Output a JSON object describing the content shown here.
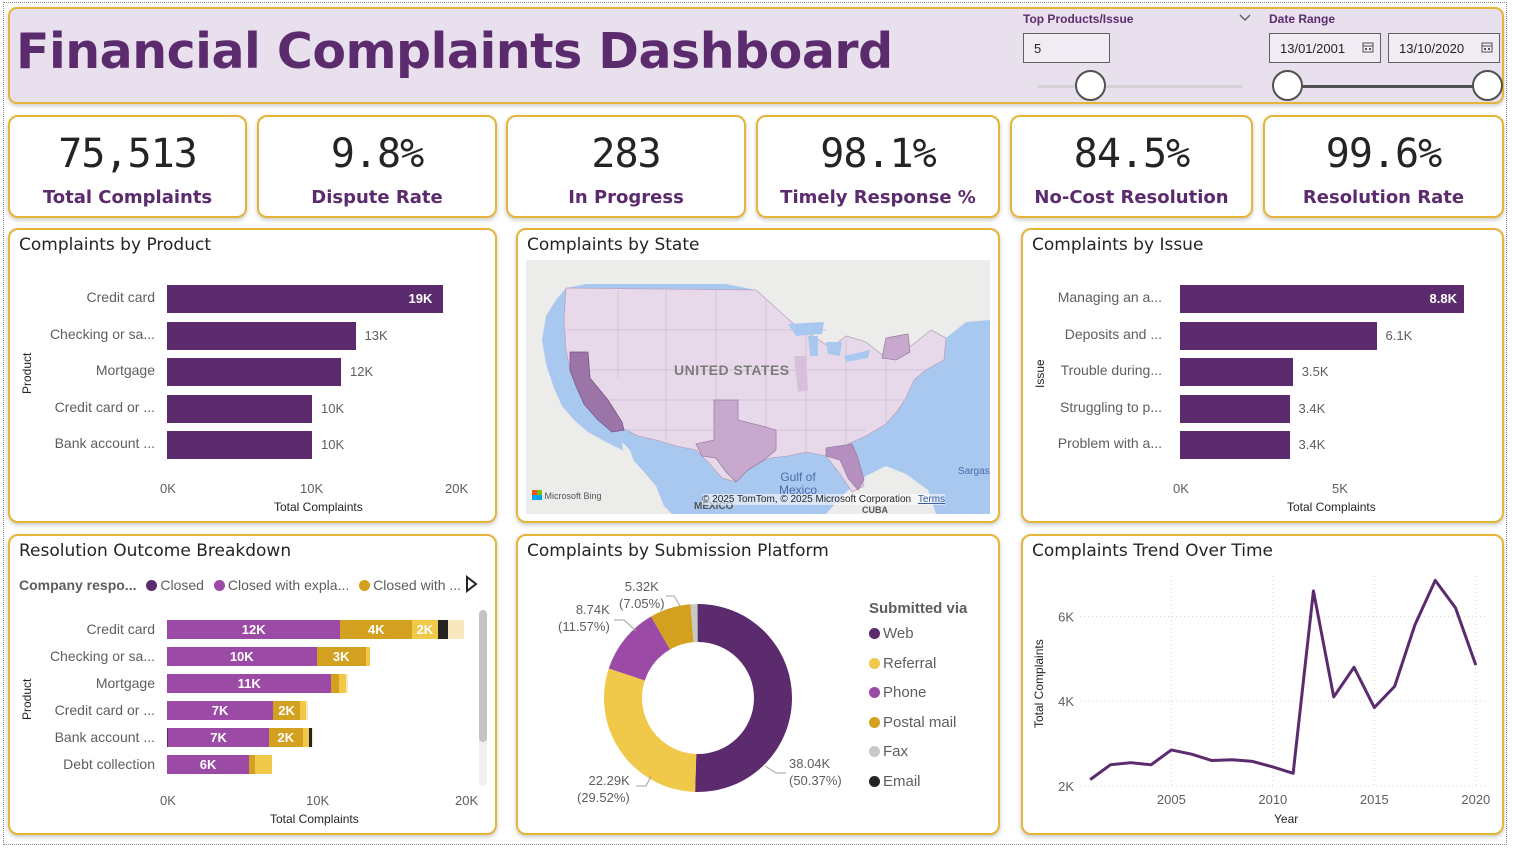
{
  "header": {
    "title": "Financial Complaints Dashboard",
    "top_slicer": {
      "label": "Top Products/Issue",
      "value": "5",
      "slider_fraction": 0.25
    },
    "date_slicer": {
      "label": "Date Range",
      "start": "13/01/2001",
      "end": "13/10/2020"
    }
  },
  "kpis": [
    {
      "value": "75,513",
      "label": "Total Complaints"
    },
    {
      "value": "9.8%",
      "label": "Dispute Rate"
    },
    {
      "value": "283",
      "label": "In Progress"
    },
    {
      "value": "98.1%",
      "label": "Timely Response %"
    },
    {
      "value": "84.5%",
      "label": "No-Cost Resolution"
    },
    {
      "value": "99.6%",
      "label": "Resolution Rate"
    }
  ],
  "product_chart": {
    "title": "Complaints by Product",
    "xlabel": "Total Complaints",
    "ylabel": "Product",
    "ticks": [
      "0K",
      "10K",
      "20K"
    ]
  },
  "state_map": {
    "title": "Complaints by State",
    "country_label": "UNITED STATES",
    "gulf_label": "Gulf of Mexico",
    "mexico_label": "MÉXICO",
    "cuba_label": "CUBA",
    "sargasso_label": "Sargas",
    "bing_label": "Microsoft Bing",
    "copyright": "© 2025 TomTom, © 2025 Microsoft Corporation",
    "terms": "Terms"
  },
  "issue_chart": {
    "title": "Complaints by Issue",
    "xlabel": "Total Complaints",
    "ylabel": "Issue",
    "ticks": [
      "0K",
      "5K"
    ]
  },
  "resolution_chart": {
    "title": "Resolution Outcome Breakdown",
    "legend_title": "Company respo...",
    "xlabel": "Total Complaints",
    "ylabel": "Product",
    "ticks": [
      "0K",
      "10K",
      "20K"
    ]
  },
  "platform_chart": {
    "title": "Complaints by Submission Platform",
    "legend_title": "Submitted via"
  },
  "trend_chart": {
    "title": "Complaints Trend Over Time",
    "xlabel": "Year",
    "ylabel": "Total Complaints",
    "xticks": [
      "2005",
      "2010",
      "2015",
      "2020"
    ],
    "yticks": [
      "2K",
      "4K",
      "6K"
    ]
  },
  "colors": {
    "purple": "#5c2b6e",
    "light_purple": "#9b4aa5",
    "gold": "#d4a020",
    "yellow": "#f0c84a",
    "grey": "#c8c8c8",
    "black": "#252423",
    "border": "#e5b53a"
  },
  "chart_data": [
    {
      "type": "bar",
      "title": "Complaints by Product",
      "xlabel": "Total Complaints",
      "ylabel": "Product",
      "categories": [
        "Credit card",
        "Checking or sa...",
        "Mortgage",
        "Credit card or ...",
        "Bank account ..."
      ],
      "values": [
        19000,
        13000,
        12000,
        10000,
        10000
      ],
      "data_labels": [
        "19K",
        "13K",
        "12K",
        "10K",
        "10K"
      ],
      "xlim": [
        0,
        20000
      ]
    },
    {
      "type": "bar",
      "title": "Complaints by Issue",
      "xlabel": "Total Complaints",
      "ylabel": "Issue",
      "categories": [
        "Managing an a...",
        "Deposits and ...",
        "Trouble during...",
        "Struggling to p...",
        "Problem with a..."
      ],
      "values": [
        8800,
        6100,
        3500,
        3400,
        3400
      ],
      "data_labels": [
        "8.8K",
        "6.1K",
        "3.5K",
        "3.4K",
        "3.4K"
      ],
      "xlim": [
        0,
        9000
      ]
    },
    {
      "type": "bar",
      "title": "Resolution Outcome Breakdown",
      "xlabel": "Total Complaints",
      "ylabel": "Product",
      "categories": [
        "Credit card",
        "Checking or sa...",
        "Mortgage",
        "Credit card or ...",
        "Bank account ...",
        "Debt collection"
      ],
      "series": [
        {
          "name": "Closed",
          "values": [
            0,
            0,
            0,
            0,
            100,
            0
          ]
        },
        {
          "name": "Closed with expla...",
          "values": [
            11600,
            10000,
            11000,
            7100,
            6700,
            5500
          ],
          "data_labels": [
            "12K",
            "10K",
            "11K",
            "7K",
            "7K",
            "6K"
          ]
        },
        {
          "name": "Closed with ...",
          "values": [
            4800,
            3300,
            500,
            1800,
            2300,
            400
          ],
          "data_labels": [
            "4K",
            "3K",
            "",
            "2K",
            "2K",
            ""
          ]
        },
        {
          "name": "",
          "values": [
            1700,
            300,
            500,
            400,
            400,
            1100
          ],
          "data_labels": [
            "2K",
            "",
            "",
            "",
            "",
            ""
          ]
        },
        {
          "name": "",
          "values": [
            700,
            0,
            0,
            0,
            200,
            0
          ]
        },
        {
          "name": "",
          "values": [
            1100,
            0,
            100,
            100,
            100,
            0
          ]
        }
      ],
      "xlim": [
        0,
        20000
      ]
    },
    {
      "type": "pie",
      "title": "Complaints by Submission Platform",
      "legend_title": "Submitted via",
      "categories": [
        "Web",
        "Referral",
        "Phone",
        "Postal mail",
        "Fax",
        "Email"
      ],
      "values": [
        38040,
        22290,
        8740,
        5320,
        900,
        50
      ],
      "slice_labels": [
        {
          "value": "38.04K",
          "pct": "(50.37%)"
        },
        {
          "value": "22.29K",
          "pct": "(29.52%)"
        },
        {
          "value": "8.74K",
          "pct": "(11.57%)"
        },
        {
          "value": "5.32K",
          "pct": "(7.05%)"
        },
        null,
        null
      ],
      "colors": [
        "#5c2b6e",
        "#f0c84a",
        "#9b4aa5",
        "#d4a020",
        "#c8c8c8",
        "#252423"
      ]
    },
    {
      "type": "line",
      "title": "Complaints Trend Over Time",
      "xlabel": "Year",
      "ylabel": "Total Complaints",
      "x": [
        2001,
        2002,
        2003,
        2004,
        2005,
        2006,
        2007,
        2008,
        2009,
        2010,
        2011,
        2012,
        2013,
        2014,
        2015,
        2016,
        2017,
        2018,
        2019,
        2020
      ],
      "values": [
        2150,
        2500,
        2550,
        2500,
        2850,
        2750,
        2600,
        2620,
        2580,
        2450,
        2300,
        6600,
        4100,
        4800,
        3850,
        4350,
        5800,
        6850,
        6200,
        4850
      ],
      "xlim": [
        2000.5,
        2020.6
      ],
      "ylim": [
        2000,
        7000
      ]
    }
  ]
}
